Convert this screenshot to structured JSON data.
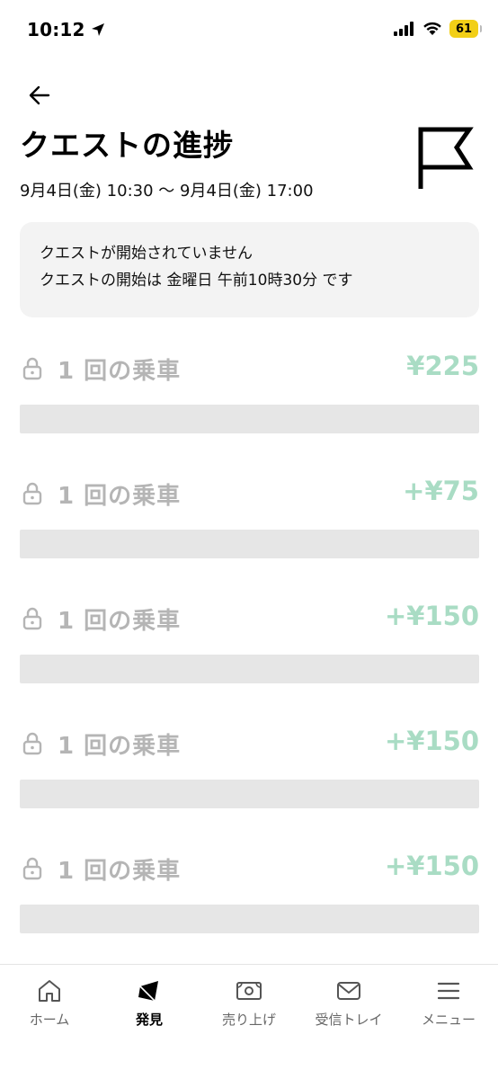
{
  "status_bar": {
    "time": "10:12",
    "battery": "61"
  },
  "header": {
    "title": "クエストの進捗",
    "date_range": "9月4日(金) 10:30 〜 9月4日(金) 17:00"
  },
  "notice": {
    "line1": "クエストが開始されていません",
    "line2": "クエストの開始は 金曜日 午前10時30分 です"
  },
  "quests": [
    {
      "label": "1 回の乗車",
      "reward": "¥225"
    },
    {
      "label": "1 回の乗車",
      "reward": "+¥75"
    },
    {
      "label": "1 回の乗車",
      "reward": "+¥150"
    },
    {
      "label": "1 回の乗車",
      "reward": "+¥150"
    },
    {
      "label": "1 回の乗車",
      "reward": "+¥150"
    }
  ],
  "bottom_nav": {
    "items": [
      {
        "label": "ホーム",
        "icon": "home-icon"
      },
      {
        "label": "発見",
        "icon": "discover-icon"
      },
      {
        "label": "売り上げ",
        "icon": "earnings-icon"
      },
      {
        "label": "受信トレイ",
        "icon": "inbox-icon"
      },
      {
        "label": "メニュー",
        "icon": "menu-icon"
      }
    ],
    "active_index": 1
  },
  "colors": {
    "reward_green": "#a9dcc4",
    "locked_gray": "#b5b5b5",
    "battery_yellow": "#f2cf17"
  }
}
